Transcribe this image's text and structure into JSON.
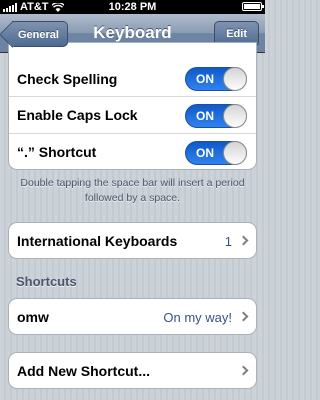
{
  "status_bar": {
    "carrier": "AT&T",
    "time": "10:28 PM",
    "icons": [
      "signal-bars-icon",
      "wifi-icon",
      "battery-icon"
    ]
  },
  "nav": {
    "back_label": "General",
    "title": "Keyboard",
    "edit_label": "Edit"
  },
  "toggles": [
    {
      "label": "Check Spelling",
      "state": "ON"
    },
    {
      "label": "Enable Caps Lock",
      "state": "ON"
    },
    {
      "label": "“.” Shortcut",
      "state": "ON"
    }
  ],
  "footnote": "Double tapping the space bar will insert a period followed by a space.",
  "international": {
    "label": "International Keyboards",
    "value": "1"
  },
  "shortcuts_header": "Shortcuts",
  "shortcut": {
    "phrase": "omw",
    "expansion": "On my way!"
  },
  "add_shortcut_label": "Add New Shortcut...",
  "colors": {
    "toggle_on": "#2f82ef",
    "nav_bar": "#6d84a2",
    "background": "#c5ccd4",
    "value_text": "#385487"
  }
}
